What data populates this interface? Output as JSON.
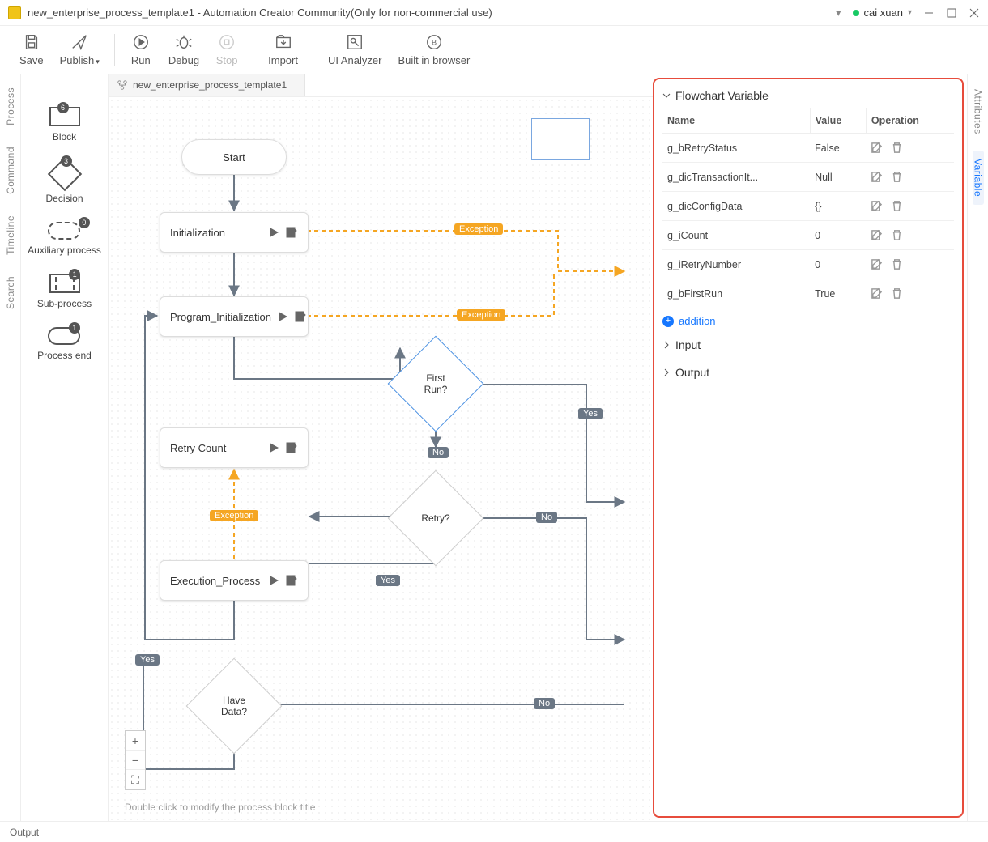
{
  "titlebar": {
    "title": "new_enterprise_process_template1 - Automation Creator Community(Only for non-commercial use)",
    "user": "cai xuan"
  },
  "toolbar": {
    "save": "Save",
    "publish": "Publish",
    "run": "Run",
    "debug": "Debug",
    "stop": "Stop",
    "import": "Import",
    "uianalyzer": "UI Analyzer",
    "browser": "Built in browser"
  },
  "left_tabs": {
    "process": "Process",
    "command": "Command",
    "timeline": "Timeline",
    "search": "Search"
  },
  "palette": {
    "block": {
      "label": "Block",
      "badge": "6"
    },
    "decision": {
      "label": "Decision",
      "badge": "3"
    },
    "aux": {
      "label": "Auxiliary process",
      "badge": "0"
    },
    "sub": {
      "label": "Sub-process",
      "badge": "1"
    },
    "end": {
      "label": "Process end",
      "badge": "1"
    }
  },
  "doc_tab": "new_enterprise_process_template1",
  "nodes": {
    "start": "Start",
    "init": "Initialization",
    "proginit": "Program_Initialization",
    "retrycount": "Retry Count",
    "exec": "Execution_Process",
    "first_run": "First\nRun?",
    "retry": "Retry?",
    "have_data": "Have\nData?"
  },
  "edge_labels": {
    "exception": "Exception",
    "yes": "Yes",
    "no": "No"
  },
  "hint": "Double click to modify the process block title",
  "right_panel": {
    "section_var": "Flowchart Variable",
    "section_input": "Input",
    "section_output": "Output",
    "headers": {
      "name": "Name",
      "value": "Value",
      "operation": "Operation"
    },
    "vars": [
      {
        "name": "g_bRetryStatus",
        "value": "False"
      },
      {
        "name": "g_dicTransactionIt...",
        "value": "Null"
      },
      {
        "name": "g_dicConfigData",
        "value": "{}"
      },
      {
        "name": "g_iCount",
        "value": "0"
      },
      {
        "name": "g_iRetryNumber",
        "value": "0"
      },
      {
        "name": "g_bFirstRun",
        "value": "True"
      }
    ],
    "addition": "addition"
  },
  "right_tabs": {
    "attributes": "Attributes",
    "variable": "Variable"
  },
  "bottombar": {
    "output": "Output"
  }
}
